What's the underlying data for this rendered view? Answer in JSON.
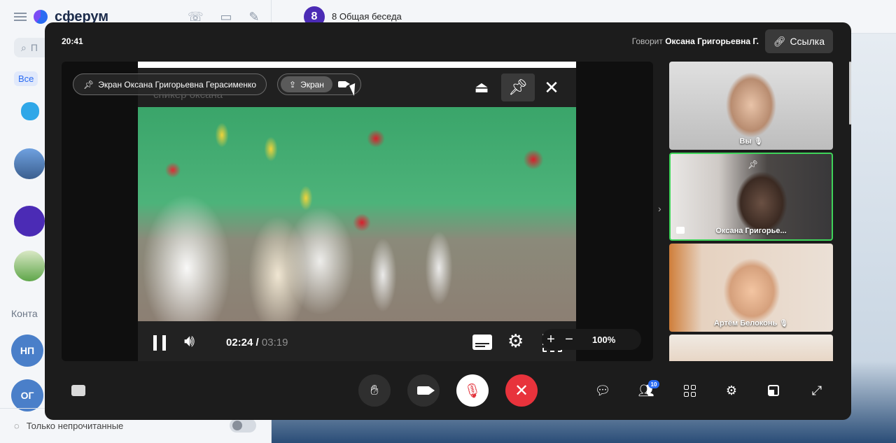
{
  "background": {
    "app_name": "сферум",
    "search_placeholder": "П",
    "filter_chip": "Все",
    "contacts_label": "Конта",
    "contact_initials": [
      "НП",
      "ОГ"
    ],
    "footer_label": "Только непрочитанные",
    "chat_avatar": "8",
    "chat_title": "8 Общая беседа"
  },
  "call": {
    "time": "20:41",
    "speaker_prefix": "Говорит",
    "speaker_name": "Оксана Григорьевна Г.",
    "link_button": "Ссылка",
    "share_label": "Экран Оксана Григорьевна Герасименко",
    "screen_tab": "Экран",
    "video": {
      "caption": "спикер оксана",
      "current_time": "02:24",
      "separator": "/",
      "total_time": "03:19",
      "progress": 0.724
    },
    "zoom": {
      "plus": "+",
      "minus": "−",
      "value": "100%"
    },
    "participants": [
      {
        "name": "Вы",
        "mic_off": true
      },
      {
        "name": "Оксана Григорье...",
        "pinned": true,
        "active_speaker": true,
        "sharing": true
      },
      {
        "name": "Артём Белоконь",
        "mic_off": true
      },
      {
        "name": ""
      }
    ],
    "participants_badge": "10",
    "colors": {
      "active_border": "#3fd45a",
      "hangup": "#e8333c",
      "badge": "#2a6bf2"
    },
    "icons": [
      "pin-icon",
      "airplay-icon",
      "close-icon",
      "pause-icon",
      "volume-icon",
      "subtitles-icon",
      "gear-icon",
      "fullscreen-icon",
      "hand-icon",
      "camera-icon",
      "mic-off-icon",
      "hangup-icon",
      "chat-icon",
      "people-icon",
      "grid-icon",
      "settings-icon",
      "layout-icon",
      "expand-icon",
      "link-icon"
    ]
  }
}
